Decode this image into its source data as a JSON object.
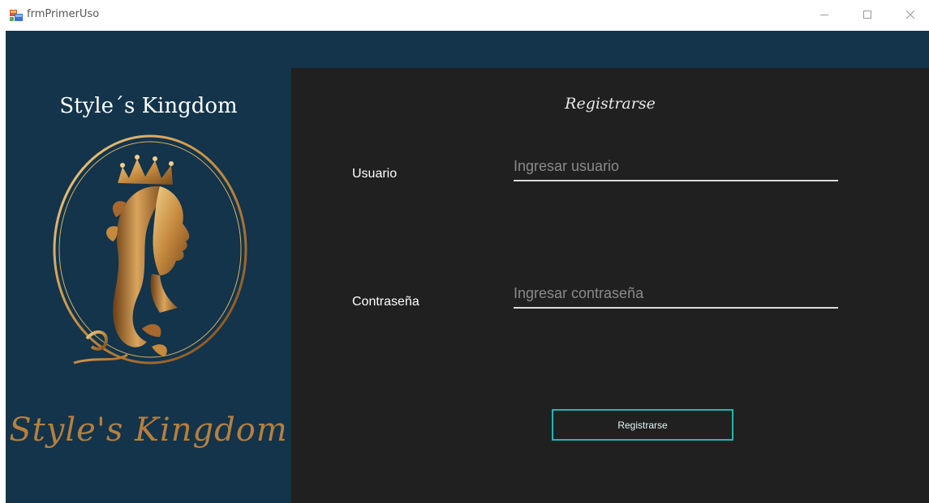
{
  "window": {
    "title": "frmPrimerUso",
    "controls": [
      "minimize-icon",
      "maximize-icon",
      "close-icon"
    ]
  },
  "left_panel": {
    "brand_title": "Style´s Kingdom",
    "script_name": "Style's Kingdom",
    "logo_icon": "queen-silhouette-crown-logo-icon"
  },
  "form": {
    "title": "Registrarse",
    "user_label": "Usuario",
    "user_placeholder": "Ingresar usuario",
    "password_label": "Contraseña",
    "password_placeholder": "Ingresar contraseña",
    "submit_label": "Registrarse"
  },
  "colors": {
    "left_panel_bg": "#13344a",
    "right_panel_bg": "#202020",
    "gold": "#b67f3e",
    "button_border": "#1fb5b5"
  }
}
